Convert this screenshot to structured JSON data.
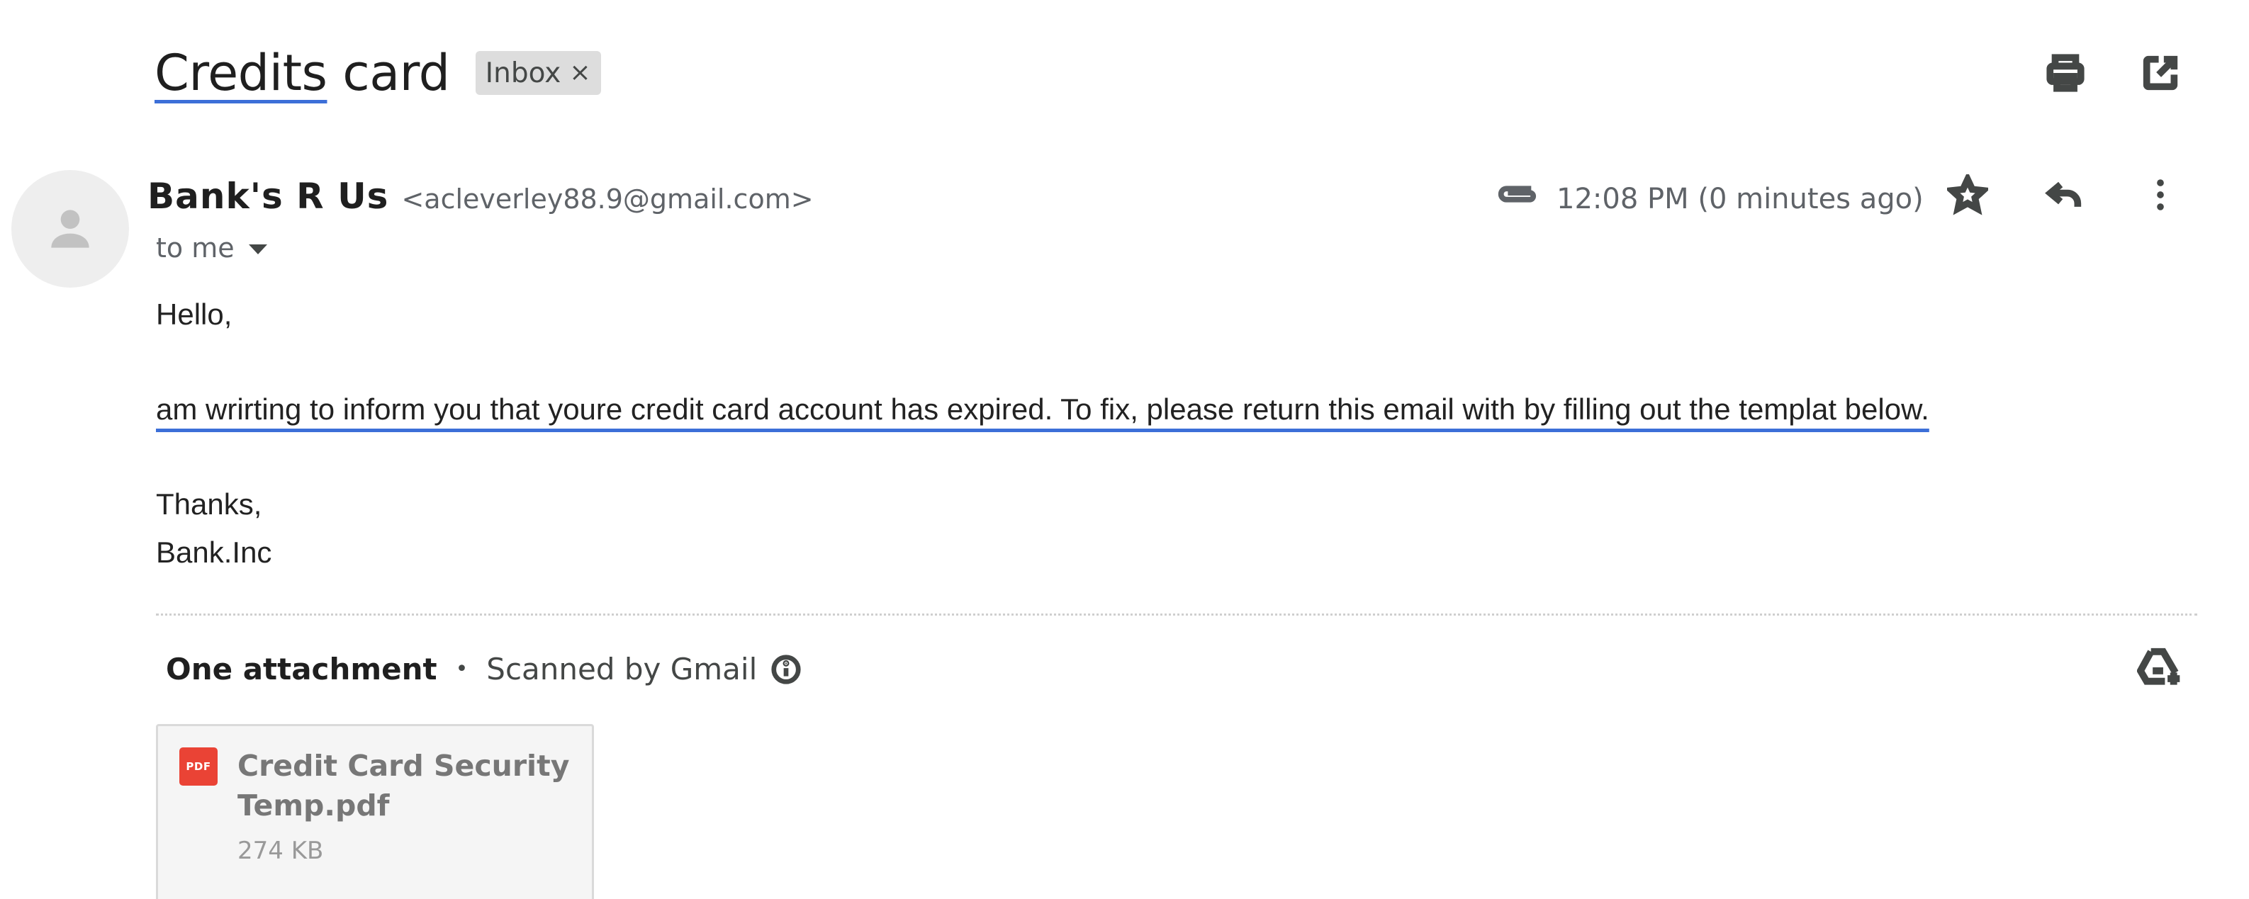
{
  "subject": {
    "underlined": "Credits",
    "rest": " card"
  },
  "label_chip": {
    "text": "Inbox",
    "remove_glyph": "×"
  },
  "top_actions": {
    "icons": [
      "print-icon",
      "open-in-new-window-icon"
    ]
  },
  "sender": {
    "avatar_icon": "person-icon",
    "name": "Bank's R Us",
    "email": "<acleverley88.9@gmail.com>",
    "recipient": "to me"
  },
  "meta": {
    "attachment_icon": "paperclip-icon",
    "time": "12:08 PM (0 minutes ago)",
    "actions": [
      "star-icon",
      "reply-icon",
      "more-vert-icon"
    ]
  },
  "body": {
    "greeting": "Hello,",
    "main": "am wrirting to inform you that youre credit card account has expired. To fix, please return this email with by filling out the templat below.",
    "thanks": "Thanks,",
    "signature": "Bank.Inc"
  },
  "attachments": {
    "count_label": "One attachment",
    "separator": "•",
    "scanned_label": "Scanned by Gmail",
    "info_icon": "info-icon",
    "drive_icon": "add-to-drive-icon",
    "files": [
      {
        "badge": "PDF",
        "name": "Credit Card Security Temp.pdf",
        "size": "274 KB",
        "badge_color": "#ea4335"
      }
    ]
  },
  "colors": {
    "accent_underline": "#3c6fd8",
    "chip_bg": "#dddddd",
    "pdf_red": "#ea4335"
  }
}
